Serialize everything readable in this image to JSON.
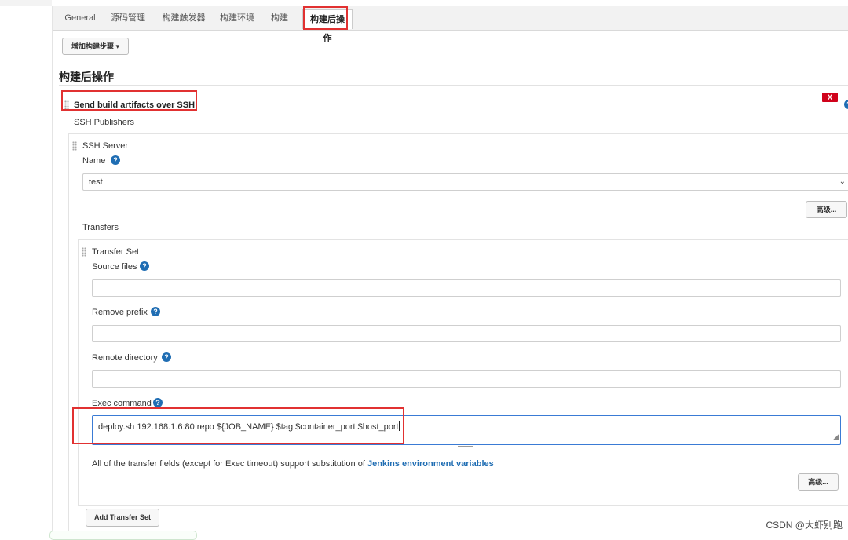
{
  "tabs": [
    {
      "label": "General"
    },
    {
      "label": "源码管理"
    },
    {
      "label": "构建触发器"
    },
    {
      "label": "构建环境"
    },
    {
      "label": "构建"
    },
    {
      "label": "构建后操作"
    }
  ],
  "add_build_step_label": "增加构建步骤 ▾",
  "section_title": "构建后操作",
  "step": {
    "title": "Send build artifacts over SSH",
    "delete_label": "X"
  },
  "ssh_publishers_label": "SSH Publishers",
  "ssh_server": {
    "title": "SSH Server",
    "name_label": "Name",
    "name_value": "test",
    "advanced_label": "高级..."
  },
  "transfers_label": "Transfers",
  "transfer_set": {
    "title": "Transfer Set",
    "source_files_label": "Source files",
    "source_files_value": "",
    "remove_prefix_label": "Remove prefix",
    "remove_prefix_value": "",
    "remote_directory_label": "Remote directory",
    "remote_directory_value": "",
    "exec_command_label": "Exec command",
    "exec_command_value": "deploy.sh 192.168.1.6:80 repo ${JOB_NAME} $tag $container_port $host_port",
    "note_prefix": "All of the transfer fields (except for Exec timeout) support substitution of",
    "note_link": "Jenkins environment variables",
    "advanced_label": "高级..."
  },
  "add_transfer_set_label": "Add Transfer Set",
  "watermark": "CSDN @大虾别跑",
  "colors": {
    "highlight_red": "#e13131",
    "help_blue": "#1f6db3",
    "delete_red": "#d0021b"
  }
}
